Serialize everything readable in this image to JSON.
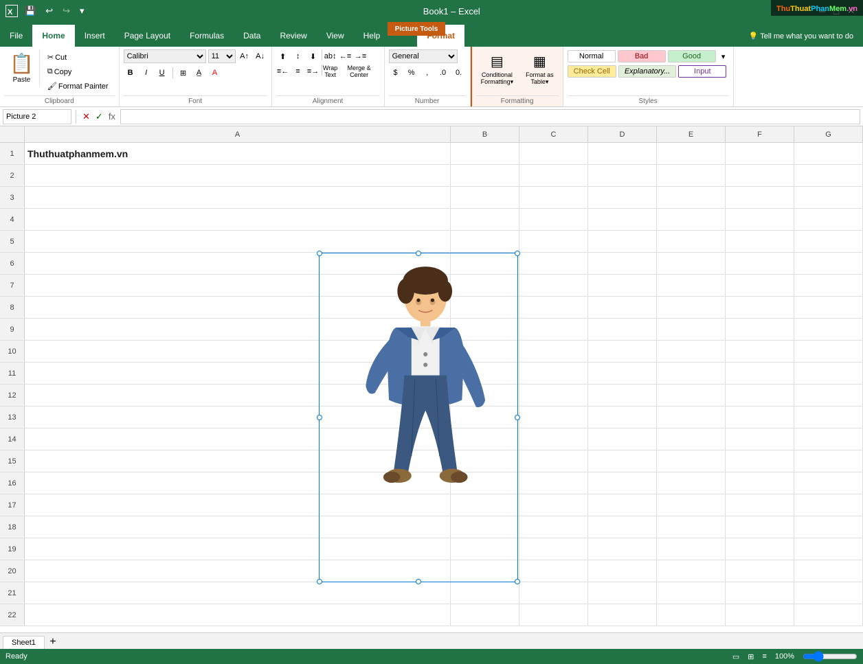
{
  "titlebar": {
    "title": "Book1 – Excel",
    "undo_label": "↩",
    "redo_label": "↪",
    "save_label": "💾",
    "customize_label": "▾"
  },
  "context_tab": {
    "label": "Picture Tools"
  },
  "context_tab_active": {
    "label": "Format"
  },
  "ribbon_tabs": [
    {
      "label": "File",
      "id": "file"
    },
    {
      "label": "Home",
      "id": "home",
      "active": true
    },
    {
      "label": "Insert",
      "id": "insert"
    },
    {
      "label": "Page Layout",
      "id": "pagelayout"
    },
    {
      "label": "Formulas",
      "id": "formulas"
    },
    {
      "label": "Data",
      "id": "data"
    },
    {
      "label": "Review",
      "id": "review"
    },
    {
      "label": "View",
      "id": "view"
    },
    {
      "label": "Help",
      "id": "help"
    },
    {
      "label": "Format",
      "id": "format_context",
      "context": true
    }
  ],
  "ribbon": {
    "clipboard": {
      "group_label": "Clipboard",
      "paste_label": "Paste",
      "cut_label": "Cut",
      "copy_label": "Copy",
      "format_painter_label": "Format Painter"
    },
    "font": {
      "group_label": "Font",
      "font_name": "Calibri",
      "font_size": "11",
      "bold_label": "B",
      "italic_label": "I",
      "underline_label": "U"
    },
    "alignment": {
      "group_label": "Alignment",
      "wrap_text_label": "Wrap Text",
      "merge_center_label": "Merge & Center"
    },
    "number": {
      "group_label": "Number",
      "format_label": "General"
    },
    "formatting": {
      "group_label": "Formatting",
      "conditional_label": "Conditional\nFormatting",
      "format_table_label": "Format as\nTable"
    },
    "styles": {
      "group_label": "Styles",
      "normal_label": "Normal",
      "bad_label": "Bad",
      "good_label": "Good",
      "check_cell_label": "Check Cell",
      "explanatory_label": "Explanatory...",
      "input_label": "Input"
    }
  },
  "formula_bar": {
    "name_box": "Picture 2",
    "cancel_btn": "✕",
    "confirm_btn": "✓",
    "function_btn": "fx",
    "formula_value": ""
  },
  "spreadsheet": {
    "columns": [
      "A",
      "B",
      "C",
      "D",
      "E",
      "F",
      "G"
    ],
    "cell_a1": "Thuthuatphanmem.vn",
    "rows": [
      1,
      2,
      3,
      4,
      5,
      6,
      7,
      8,
      9,
      10,
      11,
      12,
      13,
      14,
      15,
      16,
      17,
      18,
      19,
      20,
      21,
      22
    ]
  },
  "status_bar": {
    "ready_label": "Ready",
    "view_icons": [
      "Normal View",
      "Page Layout View",
      "Page Break View"
    ],
    "zoom_label": "100%"
  },
  "sheet_tab": "Sheet1",
  "watermark": {
    "thu": "Thu",
    "thuat": "Thuat",
    "phan": "Phan",
    "mem": "Mem",
    "vn": ".vn"
  },
  "picture": {
    "name": "Picture 2",
    "alt": "Boy running in denim jacket"
  }
}
